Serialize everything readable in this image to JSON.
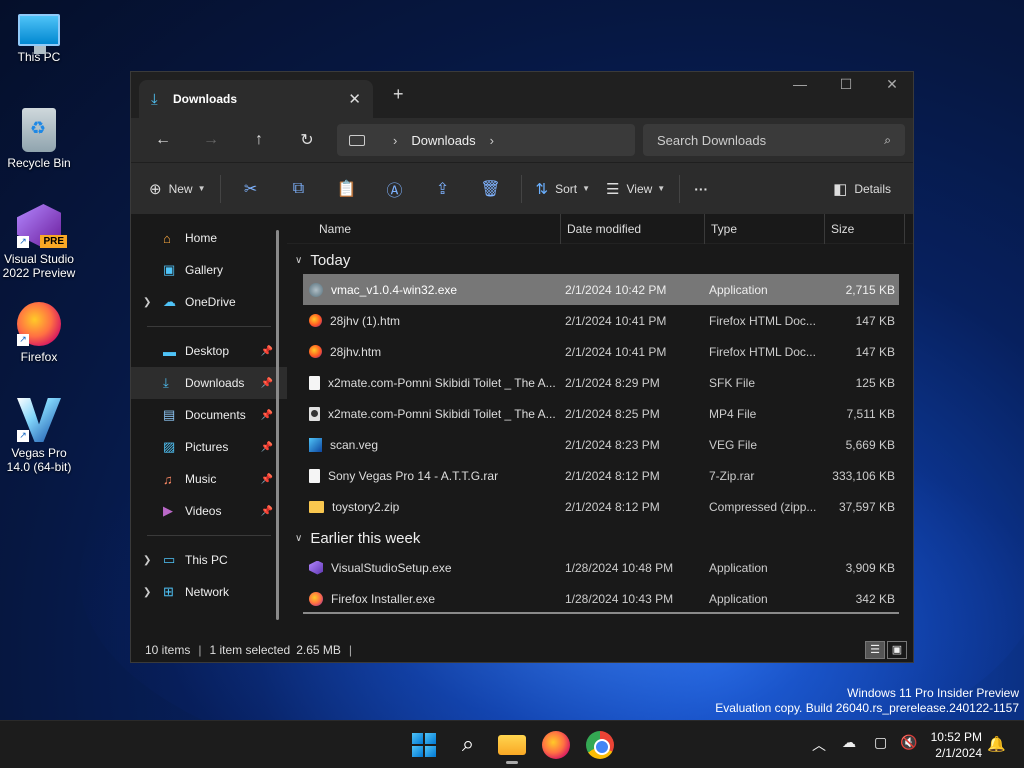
{
  "desktop": {
    "icons": [
      {
        "label": "This PC"
      },
      {
        "label": "Recycle Bin"
      },
      {
        "label": "Visual Studio 2022 Preview",
        "badge": "PRE"
      },
      {
        "label": "Firefox"
      },
      {
        "label": "Vegas Pro 14.0 (64-bit)"
      }
    ],
    "watermark_line1": "Windows 11 Pro Insider Preview",
    "watermark_line2": "Evaluation copy. Build 26040.rs_prerelease.240122-1157"
  },
  "explorer": {
    "tab_title": "Downloads",
    "new_tab_glyph": "+",
    "address": {
      "crumb": "Downloads"
    },
    "search": {
      "placeholder": "Search Downloads"
    },
    "commands": {
      "new": "New",
      "sort": "Sort",
      "view": "View",
      "more": "···",
      "details": "Details"
    },
    "nav": {
      "items": [
        {
          "label": "Home"
        },
        {
          "label": "Gallery"
        },
        {
          "label": "OneDrive"
        },
        {
          "label": "Desktop"
        },
        {
          "label": "Downloads"
        },
        {
          "label": "Documents"
        },
        {
          "label": "Pictures"
        },
        {
          "label": "Music"
        },
        {
          "label": "Videos"
        },
        {
          "label": "This PC"
        },
        {
          "label": "Network"
        }
      ]
    },
    "columns": {
      "name": "Name",
      "date": "Date modified",
      "type": "Type",
      "size": "Size"
    },
    "groups": [
      {
        "label": "Today",
        "files": [
          {
            "name": "vmac_v1.0.4-win32.exe",
            "date": "2/1/2024 10:42 PM",
            "type": "Application",
            "size": "2,715 KB",
            "icon": "exe-icon",
            "selected": true
          },
          {
            "name": "28jhv (1).htm",
            "date": "2/1/2024 10:41 PM",
            "type": "Firefox HTML Doc...",
            "size": "147 KB",
            "icon": "firefox-html-icon"
          },
          {
            "name": "28jhv.htm",
            "date": "2/1/2024 10:41 PM",
            "type": "Firefox HTML Doc...",
            "size": "147 KB",
            "icon": "firefox-html-icon"
          },
          {
            "name": "x2mate.com-Pomni Skibidi Toilet _ The A...",
            "date": "2/1/2024 8:29 PM",
            "type": "SFK File",
            "size": "125 KB",
            "icon": "document-icon"
          },
          {
            "name": "x2mate.com-Pomni Skibidi Toilet _ The A...",
            "date": "2/1/2024 8:25 PM",
            "type": "MP4 File",
            "size": "7,511 KB",
            "icon": "video-file-icon"
          },
          {
            "name": "scan.veg",
            "date": "2/1/2024 8:23 PM",
            "type": "VEG File",
            "size": "5,669 KB",
            "icon": "vegas-file-icon"
          },
          {
            "name": "Sony Vegas Pro 14 - A.T.T.G.rar",
            "date": "2/1/2024 8:12 PM",
            "type": "7-Zip.rar",
            "size": "333,106 KB",
            "icon": "document-icon"
          },
          {
            "name": "toystory2.zip",
            "date": "2/1/2024 8:12 PM",
            "type": "Compressed (zipp...",
            "size": "37,597 KB",
            "icon": "zip-folder-icon"
          }
        ]
      },
      {
        "label": "Earlier this week",
        "files": [
          {
            "name": "VisualStudioSetup.exe",
            "date": "1/28/2024 10:48 PM",
            "type": "Application",
            "size": "3,909 KB",
            "icon": "visual-studio-icon"
          },
          {
            "name": "Firefox Installer.exe",
            "date": "1/28/2024 10:43 PM",
            "type": "Application",
            "size": "342 KB",
            "icon": "firefox-icon"
          }
        ]
      }
    ],
    "status": {
      "count": "10 items",
      "selected": "1 item selected",
      "size": "2.65 MB"
    }
  },
  "taskbar": {
    "time": "10:52 PM",
    "date": "2/1/2024"
  },
  "colors": {
    "accent": "#4fc3f7",
    "selection": "#777777",
    "window_bg": "#191919"
  }
}
